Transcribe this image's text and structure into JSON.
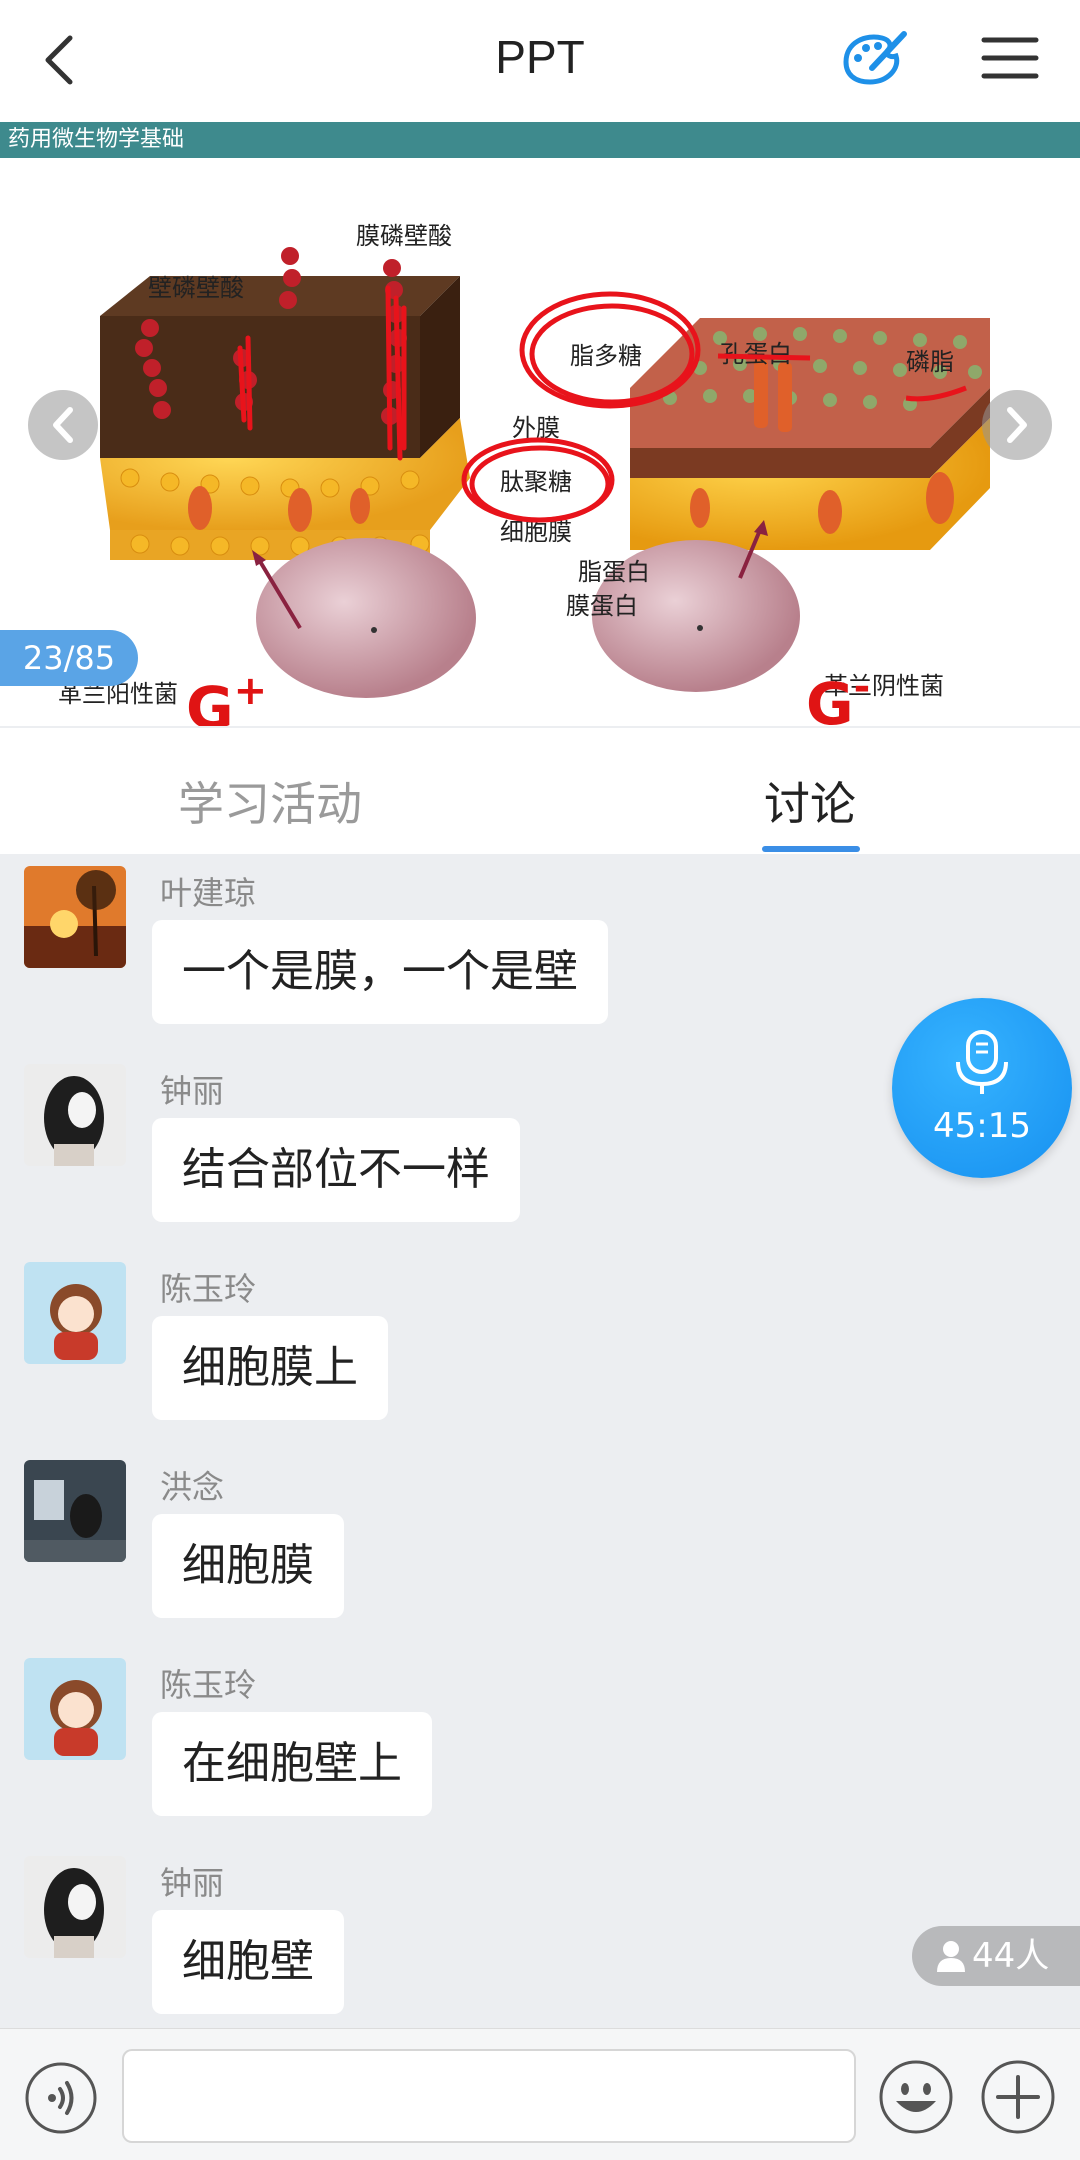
{
  "header": {
    "title": "PPT"
  },
  "slide": {
    "course_title": "药用微生物学基础",
    "page_indicator": "23/85",
    "diagram_labels": {
      "lipoteichoic_acid": "膜磷壁酸",
      "teichoic_acid": "壁磷壁酸",
      "lipopolysaccharide": "脂多糖",
      "porin": "孔蛋白",
      "phospholipid": "磷脂",
      "outer_membrane": "外膜",
      "peptidoglycan": "肽聚糖",
      "cell_membrane": "细胞膜",
      "lipoprotein": "脂蛋白",
      "membrane_protein": "膜蛋白",
      "gram_positive": "革兰阳性菌",
      "gram_negative": "革兰阴性菌",
      "g_plus": "G",
      "g_plus_sup": "+",
      "g_minus": "G",
      "g_minus_sup": "-"
    }
  },
  "tabs": {
    "activity": "学习活动",
    "discussion": "讨论"
  },
  "messages": [
    {
      "name": "叶建琼",
      "text": "一个是膜，一个是壁"
    },
    {
      "name": "钟丽",
      "text": "结合部位不一样"
    },
    {
      "name": "陈玉玲",
      "text": "细胞膜上"
    },
    {
      "name": "洪念",
      "text": "细胞膜"
    },
    {
      "name": "陈玉玲",
      "text": "在细胞壁上"
    },
    {
      "name": "钟丽",
      "text": "细胞壁"
    }
  ],
  "mic": {
    "time": "45:15"
  },
  "online": {
    "count": "44人"
  },
  "input": {
    "placeholder": ""
  },
  "colors": {
    "accent": "#3a8ee6",
    "mic": "#1a95f2",
    "slide_bar": "#3e8a8d",
    "annotation": "#e8131b"
  }
}
